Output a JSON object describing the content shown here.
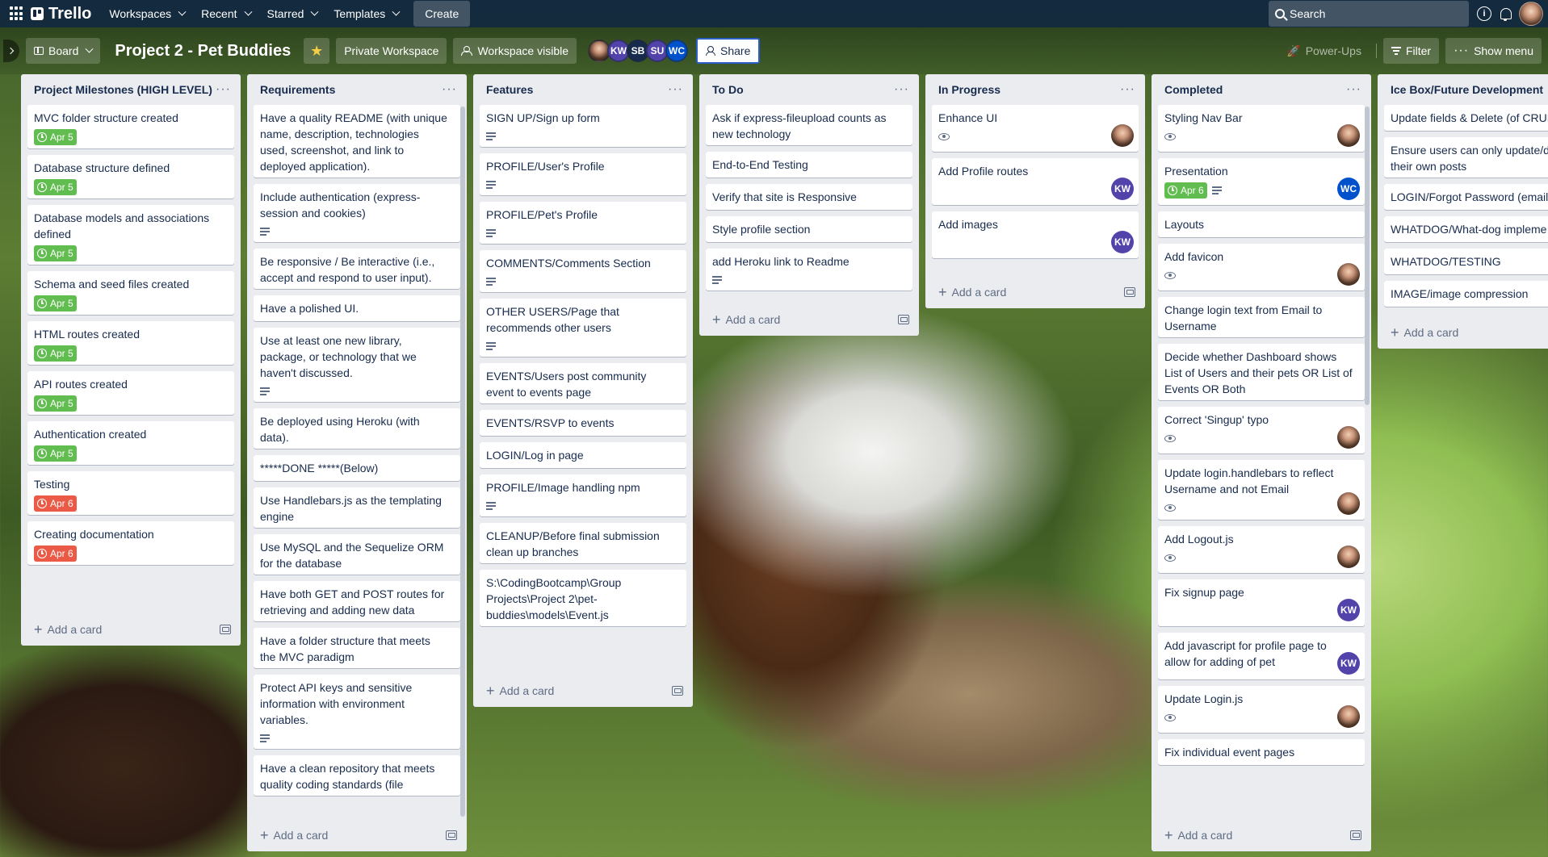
{
  "nav": {
    "logo": "Trello",
    "items": [
      "Workspaces",
      "Recent",
      "Starred",
      "Templates"
    ],
    "create": "Create",
    "search_placeholder": "Search"
  },
  "board": {
    "view": "Board",
    "title": "Project 2 - Pet Buddies",
    "workspace": "Private Workspace",
    "visibility": "Workspace visible",
    "members": [
      "KW",
      "SB",
      "SU",
      "WC"
    ],
    "share": "Share",
    "powerups": "Power-Ups",
    "filter": "Filter",
    "show_menu": "Show menu"
  },
  "footer_label": "Add a card",
  "lists": [
    {
      "title": "Project Milestones (HIGH LEVEL)",
      "cards": [
        {
          "text": "MVC folder structure created",
          "due": "Apr 5",
          "due_color": "green"
        },
        {
          "text": "Database structure defined",
          "due": "Apr 5",
          "due_color": "green"
        },
        {
          "text": "Database models and associations defined",
          "due": "Apr 5",
          "due_color": "green"
        },
        {
          "text": "Schema and seed files created",
          "due": "Apr 5",
          "due_color": "green"
        },
        {
          "text": "HTML routes created",
          "due": "Apr 5",
          "due_color": "green"
        },
        {
          "text": "API routes created",
          "due": "Apr 5",
          "due_color": "green"
        },
        {
          "text": "Authentication created",
          "due": "Apr 5",
          "due_color": "green"
        },
        {
          "text": "Testing",
          "due": "Apr 6",
          "due_color": "red"
        },
        {
          "text": "Creating documentation",
          "due": "Apr 6",
          "due_color": "red"
        }
      ]
    },
    {
      "title": "Requirements",
      "cards": [
        {
          "text": "Have a quality README (with unique name, description, technologies used, screenshot, and link to deployed application)."
        },
        {
          "text": "Include authentication (express-session and cookies)",
          "desc": true
        },
        {
          "text": "Be responsive / Be interactive (i.e., accept and respond to user input)."
        },
        {
          "text": "Have a polished UI."
        },
        {
          "text": "Use at least one new library, package, or technology that we haven't discussed.",
          "desc": true
        },
        {
          "text": "Be deployed using Heroku (with data)."
        },
        {
          "text": "*****DONE *****(Below)"
        },
        {
          "text": "Use Handlebars.js as the templating engine"
        },
        {
          "text": "Use MySQL and the Sequelize ORM for the database"
        },
        {
          "text": "Have both GET and POST routes for retrieving and adding new data"
        },
        {
          "text": "Have a folder structure that meets the MVC paradigm"
        },
        {
          "text": "Protect API keys and sensitive information with environment variables.",
          "desc": true
        },
        {
          "text": "Have a clean repository that meets quality coding standards (file"
        }
      ]
    },
    {
      "title": "Features",
      "cards": [
        {
          "text": "SIGN UP/Sign up form",
          "desc": true
        },
        {
          "text": "PROFILE/User's Profile",
          "desc": true
        },
        {
          "text": "PROFILE/Pet's Profile",
          "desc": true
        },
        {
          "text": "COMMENTS/Comments Section",
          "desc": true
        },
        {
          "text": "OTHER USERS/Page that recommends other users",
          "desc": true
        },
        {
          "text": "EVENTS/Users post community event to events page"
        },
        {
          "text": "EVENTS/RSVP to events"
        },
        {
          "text": "LOGIN/Log in page"
        },
        {
          "text": "PROFILE/Image handling npm",
          "desc": true
        },
        {
          "text": "CLEANUP/Before final submission clean up branches"
        },
        {
          "text": "S:\\CodingBootcamp\\Group Projects\\Project 2\\pet-buddies\\models\\Event.js"
        }
      ]
    },
    {
      "title": "To Do",
      "cards": [
        {
          "text": "Ask if express-fileupload counts as new technology"
        },
        {
          "text": "End-to-End Testing"
        },
        {
          "text": "Verify that site is Responsive"
        },
        {
          "text": "Style profile section"
        },
        {
          "text": "add Heroku link to Readme",
          "desc": true
        }
      ]
    },
    {
      "title": "In Progress",
      "cards": [
        {
          "text": "Enhance UI",
          "watch": true,
          "avatar": "photo"
        },
        {
          "text": "Add Profile routes",
          "avatar": "KW"
        },
        {
          "text": "Add images",
          "avatar": "KW"
        }
      ]
    },
    {
      "title": "Completed",
      "cards": [
        {
          "text": "Styling Nav Bar",
          "watch": true,
          "avatar": "photo"
        },
        {
          "text": "Presentation",
          "due": "Apr 6",
          "due_color": "green",
          "desc": true,
          "avatar": "WC"
        },
        {
          "text": "Layouts"
        },
        {
          "text": "Add favicon",
          "watch": true,
          "avatar": "photo"
        },
        {
          "text": "Change login text from Email to Username"
        },
        {
          "text": "Decide whether Dashboard shows List of Users and their pets OR List of Events OR Both"
        },
        {
          "text": "Correct 'Singup' typo",
          "watch": true,
          "avatar": "photo"
        },
        {
          "text": "Update login.handlebars to reflect Username and not Email",
          "watch": true,
          "avatar": "photo"
        },
        {
          "text": "Add Logout.js",
          "watch": true,
          "avatar": "photo"
        },
        {
          "text": "Fix signup page",
          "avatar": "KW"
        },
        {
          "text": "Add javascript for profile page to allow for adding of pet",
          "avatar": "KW"
        },
        {
          "text": "Update Login.js",
          "watch": true,
          "avatar": "photo"
        },
        {
          "text": "Fix individual event pages"
        }
      ]
    },
    {
      "title": "Ice Box/Future Development",
      "cards": [
        {
          "text": "Update fields & Delete (of CRUD"
        },
        {
          "text": "Ensure users can only update/de their own posts"
        },
        {
          "text": "LOGIN/Forgot Password (email"
        },
        {
          "text": "WHATDOG/What-dog impleme"
        },
        {
          "text": "WHATDOG/TESTING"
        },
        {
          "text": "IMAGE/image compression"
        }
      ]
    }
  ]
}
